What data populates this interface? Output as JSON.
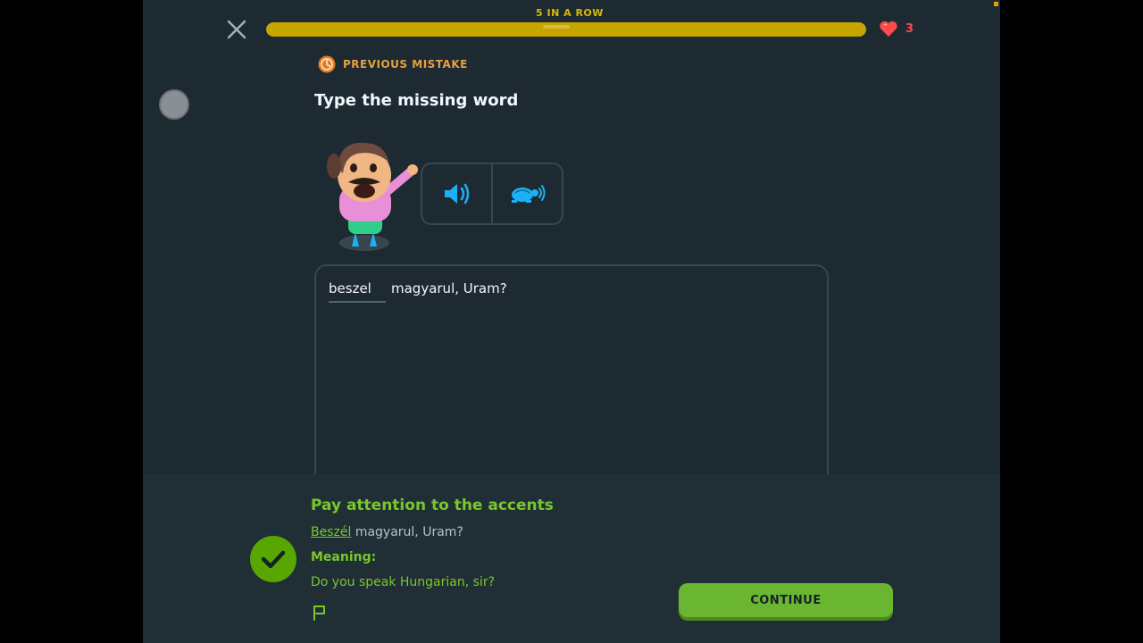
{
  "header": {
    "close_icon": "close-icon",
    "streak_label": "5 IN A ROW",
    "progress_fraction": 1.0,
    "progress_color": "#c7a600",
    "hearts_icon": "heart-icon",
    "hearts_count": "3",
    "hearts_color": "#ff4b4b"
  },
  "challenge": {
    "badge_icon": "previous-mistake-icon",
    "badge_label": "PREVIOUS MISTAKE",
    "instruction": "Type the missing word",
    "audio_buttons": [
      {
        "name": "speaker-icon"
      },
      {
        "name": "turtle-slow-audio-icon"
      }
    ],
    "blank_value": "beszel",
    "sentence_rest": "magyarul, Uram?"
  },
  "feedback": {
    "icon": "checkmark-icon",
    "title": "Pay attention to the accents",
    "answer_word": "Beszél",
    "answer_rest": " magyarul, Uram?",
    "meaning_label": "Meaning:",
    "meaning": "Do you speak Hungarian, sir?",
    "report_icon": "flag-icon",
    "continue_label": "CONTINUE",
    "accent_color": "#58a700"
  }
}
